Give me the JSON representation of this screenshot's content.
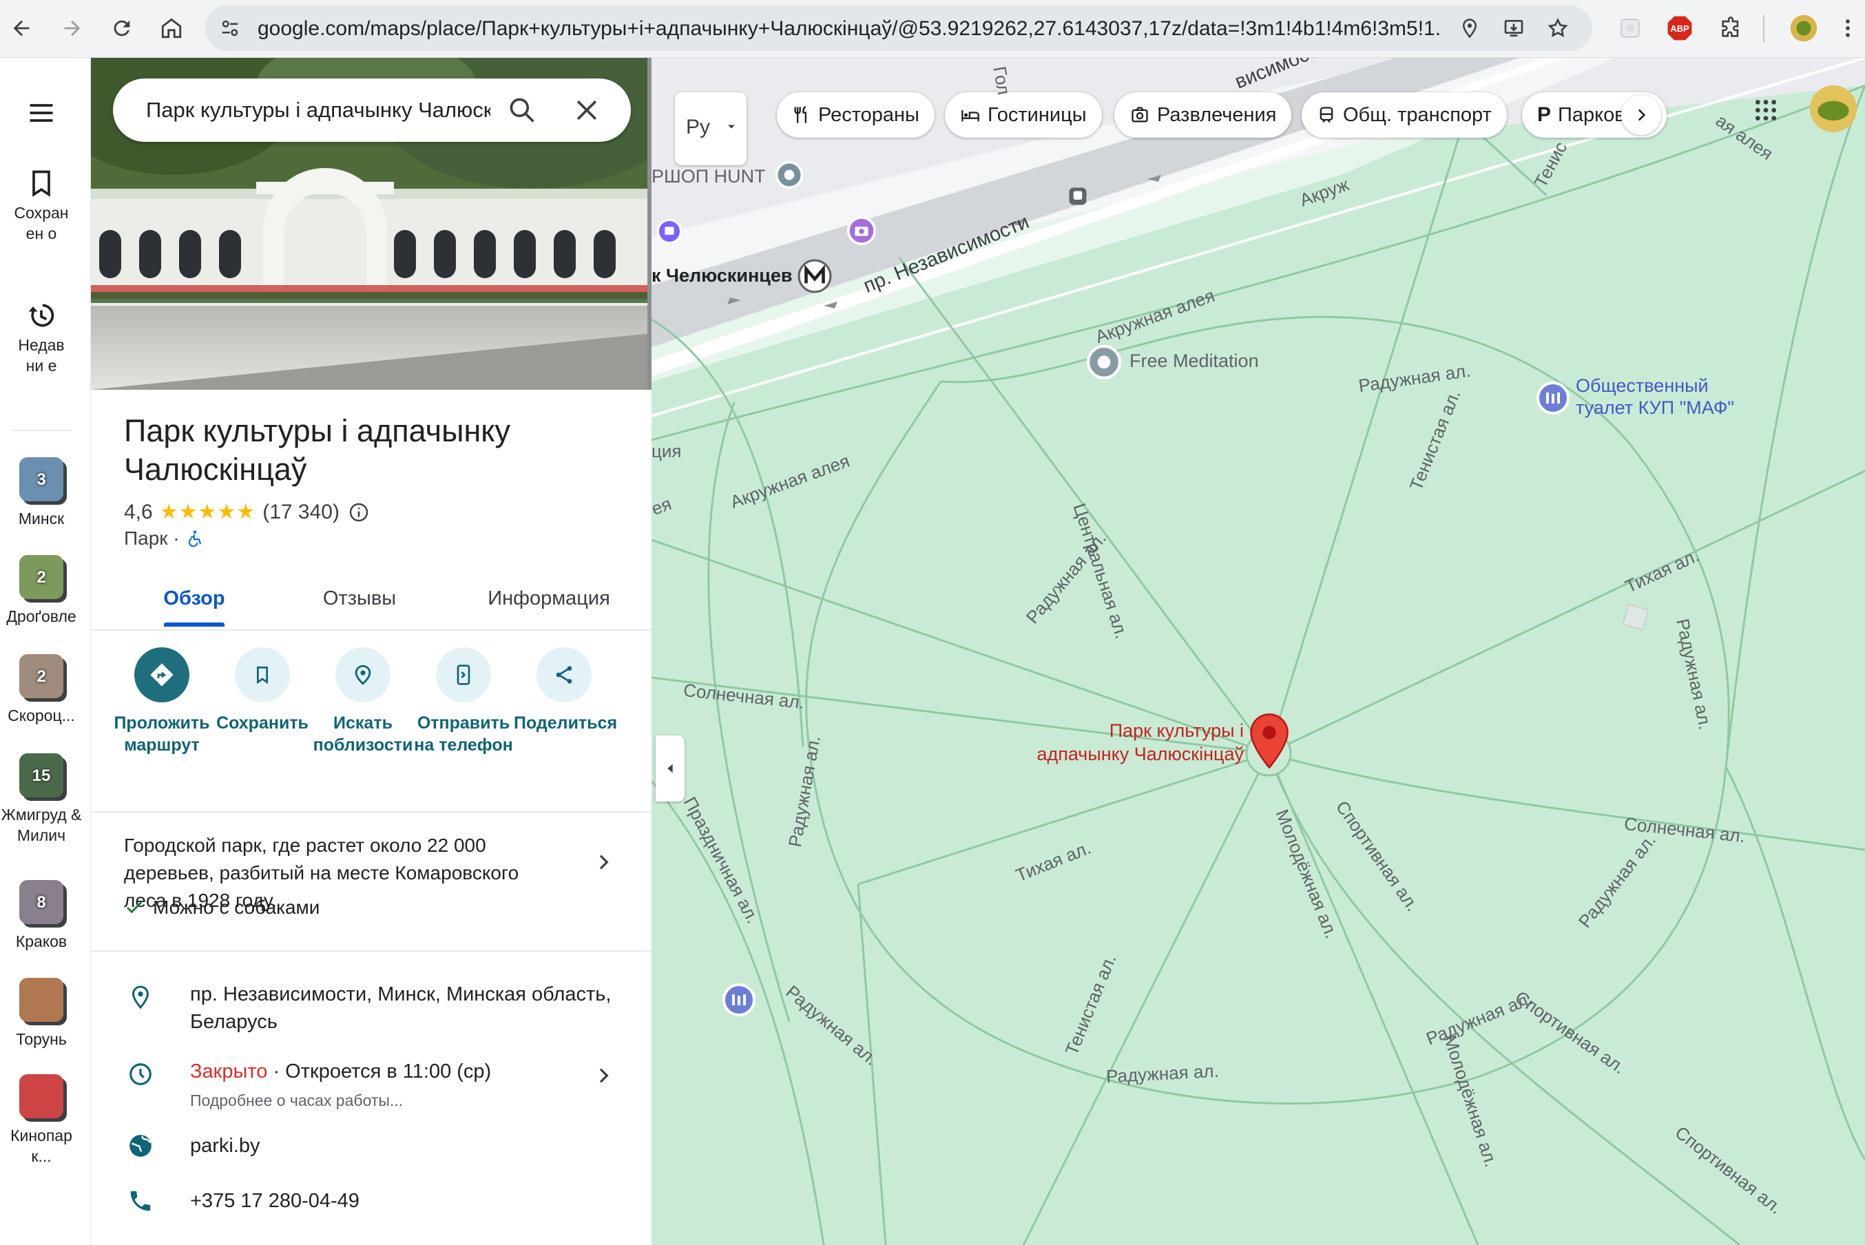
{
  "browser": {
    "url": "google.com/maps/place/Парк+культуры+і+адпачынку+Чалюскінцаў/@53.9219262,27.6143037,17z/data=!3m1!4b1!4m6!3m5!1...",
    "icons": [
      "back-icon",
      "forward-icon",
      "reload-icon",
      "home-icon",
      "site-settings-icon",
      "location-icon",
      "install-icon",
      "bookmark-star-icon",
      "extension-icon",
      "adblock-icon",
      "puzzle-icon",
      "profile-avatar",
      "menu-dots-icon"
    ],
    "adblock_label": "ABP"
  },
  "rail": {
    "saved_label": "Сохранен о",
    "recent_label": "Недавни е",
    "recents": [
      {
        "label": "Минск",
        "count": "3",
        "color": "#6a8fb0"
      },
      {
        "label": "Дроґовле",
        "count": "2",
        "color": "#7c9a5a"
      },
      {
        "label": "Скороц...",
        "count": "2",
        "color": "#a08c7a"
      },
      {
        "label": "Жмигруд & Милич",
        "count": "15",
        "color": "#4a6a4a"
      },
      {
        "label": "Краков",
        "count": "8",
        "color": "#8a7f8c"
      },
      {
        "label": "Торунь",
        "count": "",
        "color": "#b07850"
      },
      {
        "label": "Кинопар к...",
        "count": "",
        "color": "#c44"
      }
    ]
  },
  "panel": {
    "search_value": "Парк культуры і адпачынку Чалюскінцаў",
    "title": "Парк культуры і адпачынку Чалюскінцаў",
    "rating": "4,6",
    "stars": "★★★★★",
    "reviews": "(17 340)",
    "type": "Парк ·",
    "tabs": [
      "Обзор",
      "Отзывы",
      "Информация"
    ],
    "actions": [
      {
        "label": "Проложить маршрут"
      },
      {
        "label": "Сохранить"
      },
      {
        "label": "Искать поблизости"
      },
      {
        "label": "Отправить на телефон"
      },
      {
        "label": "Поделиться"
      }
    ],
    "description": "Городской парк, где растет около 22 000 деревьев, разбитый на месте Комаровского леса в 1928 году.",
    "dogs": "Можно с собаками",
    "address": "пр. Независимости, Минск, Минская область, Беларусь",
    "hours_status": "Закрыто",
    "hours_next": " · Откроется в 11:00 (ср)",
    "hours_more": "Подробнее о часах работы...",
    "website": "parki.by",
    "phone": "+375 17 280-04-49",
    "colors": {
      "closed": "#d93025",
      "accent": "#0b57d0",
      "action": "#1f6e7e"
    }
  },
  "map": {
    "lang_button": "Ру",
    "chips": [
      "Рестораны",
      "Гостиницы",
      "Развлечения",
      "Общ. транспорт",
      "Парковка"
    ],
    "place_label": "Парк культуры і адпачынку Чалюскінцаў",
    "place_label_line1": "Парк культуры і",
    "place_label_line2": "адпачынку Чалюскінцаў",
    "pois": {
      "meditation": "Free Meditation",
      "toilet": "Общественный туалет КУП \"МАФ\"",
      "toilet_line1": "Общественный",
      "toilet_line2": "туалет КУП \"МАФ\"",
      "shop": "РШОП HUNT",
      "metro": "к Челюскинцев"
    },
    "streets": {
      "main": "пр. Независимости",
      "main_top": "висимост",
      "gol": "Гол",
      "akr1": "Акружная алея",
      "akr2": "Акружная алея",
      "akr3": "Акруж",
      "radu1": "Радужная ал.",
      "radu2": "Радужная ал.",
      "radu3": "Радужная ал.",
      "radu4": "Радужная ал.",
      "radu5": "Радужная ал.",
      "radu6": "Радужная ал.",
      "radu7": "Радужная ал.",
      "radu8": "Радужная ал.",
      "central": "Центральная ал.",
      "tenistaya1": "Тенистая ал.",
      "tenistaya2": "Тенистая ал.",
      "tenistaya3": "Тенис",
      "tikhaya1": "Тихая ал.",
      "tikhaya2": "Тихая ал.",
      "solnech1": "Солнечная ал.",
      "solnech2": "Солнечная ал.",
      "prazd": "Праздничная ал.",
      "molod1": "Молодёжная ал.",
      "molod2": "Молодёжная ал.",
      "sport1": "Спортивная ал.",
      "sport2": "Спортивная ал.",
      "sport3": "Спортивная ал.",
      "kr_alea": "ая алея",
      "iya": "ция",
      "ya": "ея"
    }
  }
}
